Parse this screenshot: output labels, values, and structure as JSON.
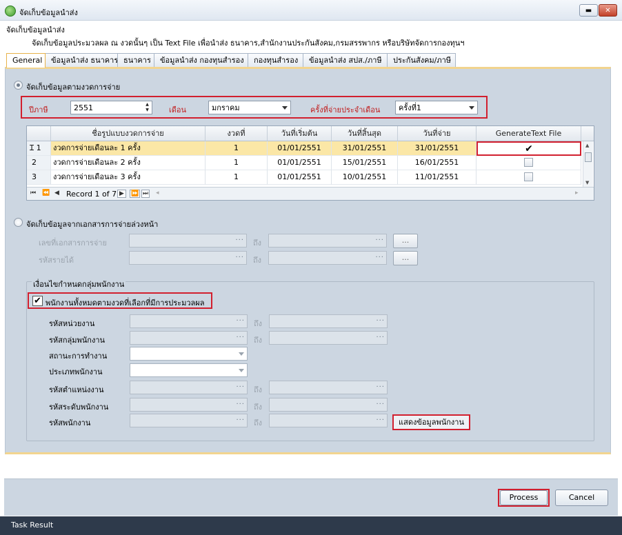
{
  "window": {
    "title": "จัดเก็บข้อมูลนำส่ง"
  },
  "header": {
    "title": "จัดเก็บข้อมูลนำส่ง",
    "description": "จัดเก็บข้อมูลประมวลผล ณ งวดนั้นๆ เป็น Text File เพื่อนำส่ง ธนาคาร,สำนักงานประกันสังคม,กรมสรรพากร หรือบริษัทจัดการกองทุนฯ"
  },
  "tabs": [
    {
      "label": "General",
      "active": true
    },
    {
      "label": "ข้อมูลนำส่ง ธนาคาร"
    },
    {
      "label": "ธนาคาร"
    },
    {
      "label": "ข้อมูลนำส่ง กองทุนสำรอง"
    },
    {
      "label": "กองทุนสำรอง"
    },
    {
      "label": "ข้อมูลนำส่ง สปส./ภาษี"
    },
    {
      "label": "ประกันสังคม/ภาษี"
    }
  ],
  "period": {
    "option_label": "จัดเก็บข้อมูลตามงวดการจ่าย",
    "selected": true,
    "year_label": "ปีภาษี",
    "year_value": "2551",
    "month_label": "เดือน",
    "month_value": "มกราคม",
    "round_label": "ครั้งที่จ่ายประจำเดือน",
    "round_value": "ครั้งที่1"
  },
  "grid": {
    "columns": [
      "ชื่อรูปแบบงวดการจ่าย",
      "งวดที่",
      "วันที่เริ่มต้น",
      "วันที่สิ้นสุด",
      "วันที่จ่าย",
      "GenerateText File"
    ],
    "rows": [
      {
        "no": "1",
        "name": "งวดการจ่ายเดือนละ 1 ครั้ง",
        "period": "1",
        "start": "01/01/2551",
        "end": "31/01/2551",
        "pay": "31/01/2551",
        "generate": true,
        "selected": true
      },
      {
        "no": "2",
        "name": "งวดการจ่ายเดือนละ 2 ครั้ง",
        "period": "1",
        "start": "01/01/2551",
        "end": "15/01/2551",
        "pay": "16/01/2551",
        "generate": false
      },
      {
        "no": "3",
        "name": "งวดการจ่ายเดือนละ 3 ครั้ง",
        "period": "1",
        "start": "01/01/2551",
        "end": "10/01/2551",
        "pay": "11/01/2551",
        "generate": false
      }
    ],
    "record_text": "Record 1 of 7"
  },
  "advance": {
    "option_label": "จัดเก็บข้อมูลจากเอกสารการจ่ายล่วงหน้า",
    "selected": false,
    "doc_label": "เลขที่เอกสารการจ่าย",
    "income_label": "รหัสรายได้",
    "to_label": "ถึง",
    "browse_label": "..."
  },
  "employee_group": {
    "title": "เงื่อนไขกำหนดกลุ่มพนักงาน",
    "all_label": "พนักงานทั้งหมดตามงวดที่เลือกที่มีการประมวลผล",
    "all_checked": true,
    "to_label": "ถึง",
    "fields": [
      {
        "label": "รหัสหน่วยงาน",
        "type": "range"
      },
      {
        "label": "รหัสกลุ่มพนักงาน",
        "type": "range"
      },
      {
        "label": "สถานะการทำงาน",
        "type": "dropdown"
      },
      {
        "label": "ประเภทพนักงาน",
        "type": "dropdown"
      },
      {
        "label": "รหัสตำแหน่งงาน",
        "type": "range"
      },
      {
        "label": "รหัสระดับพนักงาน",
        "type": "range"
      },
      {
        "label": "รหัสพนักงาน",
        "type": "range"
      }
    ],
    "show_button": "แสดงข้อมูลพนักงาน"
  },
  "buttons": {
    "process": "Process",
    "cancel": "Cancel"
  },
  "status": {
    "label": "Task Result"
  }
}
